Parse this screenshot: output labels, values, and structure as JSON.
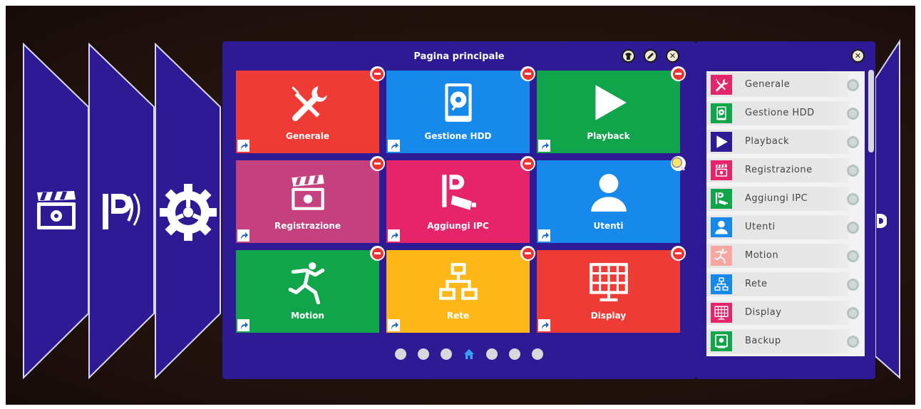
{
  "main_panel": {
    "title": "Pagina principale",
    "buttons": {
      "shirt": "shirt-icon",
      "edit": "pencil-icon",
      "close": "close-icon"
    }
  },
  "tiles": [
    {
      "label": "Generale",
      "color": "#ef3b36",
      "icon": "tools-icon"
    },
    {
      "label": "Gestione HDD",
      "color": "#1689ea",
      "icon": "hdd-icon"
    },
    {
      "label": "Playback",
      "color": "#10a54a",
      "icon": "play-icon"
    },
    {
      "label": "Registrazione",
      "color": "#c5407f",
      "icon": "clapperboard-icon"
    },
    {
      "label": "Aggiungi IPC",
      "color": "#e6246a",
      "icon": "ip-camera-icon"
    },
    {
      "label": "Utenti",
      "color": "#1689ea",
      "icon": "user-icon"
    },
    {
      "label": "Motion",
      "color": "#10a54a",
      "icon": "running-man-icon"
    },
    {
      "label": "Rete",
      "color": "#fdb719",
      "icon": "network-icon"
    },
    {
      "label": "Display",
      "color": "#ef3b36",
      "icon": "display-icon"
    }
  ],
  "page_dots": {
    "count": 7,
    "active_index": 3
  },
  "side_list": [
    {
      "label": "Generale",
      "color": "#e6246a",
      "icon": "tools-icon"
    },
    {
      "label": "Gestione HDD",
      "color": "#10a54a",
      "icon": "hdd-icon"
    },
    {
      "label": "Playback",
      "color": "#2e1a95",
      "icon": "play-icon"
    },
    {
      "label": "Registrazione",
      "color": "#e6246a",
      "icon": "clapperboard-icon"
    },
    {
      "label": "Aggiungi IPC",
      "color": "#10a54a",
      "icon": "ip-camera-icon"
    },
    {
      "label": "Utenti",
      "color": "#1689ea",
      "icon": "user-icon"
    },
    {
      "label": "Motion",
      "color": "#f7a7a0",
      "icon": "running-man-icon"
    },
    {
      "label": "Rete",
      "color": "#1689ea",
      "icon": "network-icon"
    },
    {
      "label": "Display",
      "color": "#e6246a",
      "icon": "display-icon"
    },
    {
      "label": "Backup",
      "color": "#10a54a",
      "icon": "backup-icon"
    }
  ],
  "left_panels": [
    "clapperboard-icon",
    "ip-camera-icon",
    "gear-icon"
  ]
}
